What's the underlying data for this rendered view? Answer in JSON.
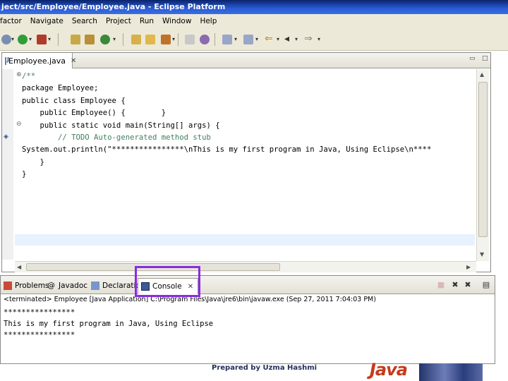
{
  "window": {
    "title": "ject/src/Employee/Employee.java - Eclipse Platform"
  },
  "menu": [
    "factor",
    "Navigate",
    "Search",
    "Project",
    "Run",
    "Window",
    "Help"
  ],
  "editor": {
    "tab_label": "Employee.java",
    "code_lines": [
      "/**",
      "package Employee;",
      "public class Employee {",
      "    public Employee() {        }",
      "    public static void main(String[] args) {",
      "        // TODO Auto-generated method stub",
      "System.out.println(\"****************\\nThis is my first program in Java, Using Eclipse\\n****",
      "    }",
      "}"
    ]
  },
  "bottom_panel": {
    "tabs": {
      "problems": "Problems",
      "javadoc": "Javadoc",
      "declaration": "Declaration",
      "console": "Console"
    },
    "status": "<terminated> Employee [Java Application] C:\\Program Files\\Java\\jre6\\bin\\javaw.exe (Sep 27, 2011 7:04:03 PM)",
    "output": [
      "****************",
      "This is my first program in Java, Using Eclipse",
      "****************"
    ]
  },
  "footer": {
    "credit": "Prepared by Uzma Hashmi",
    "logo_text": "Java"
  },
  "colors": {
    "highlight_box": "#8a2be2",
    "keyword": "#7f0055",
    "string": "#2a00ff",
    "comment": "#3f7f5f"
  }
}
